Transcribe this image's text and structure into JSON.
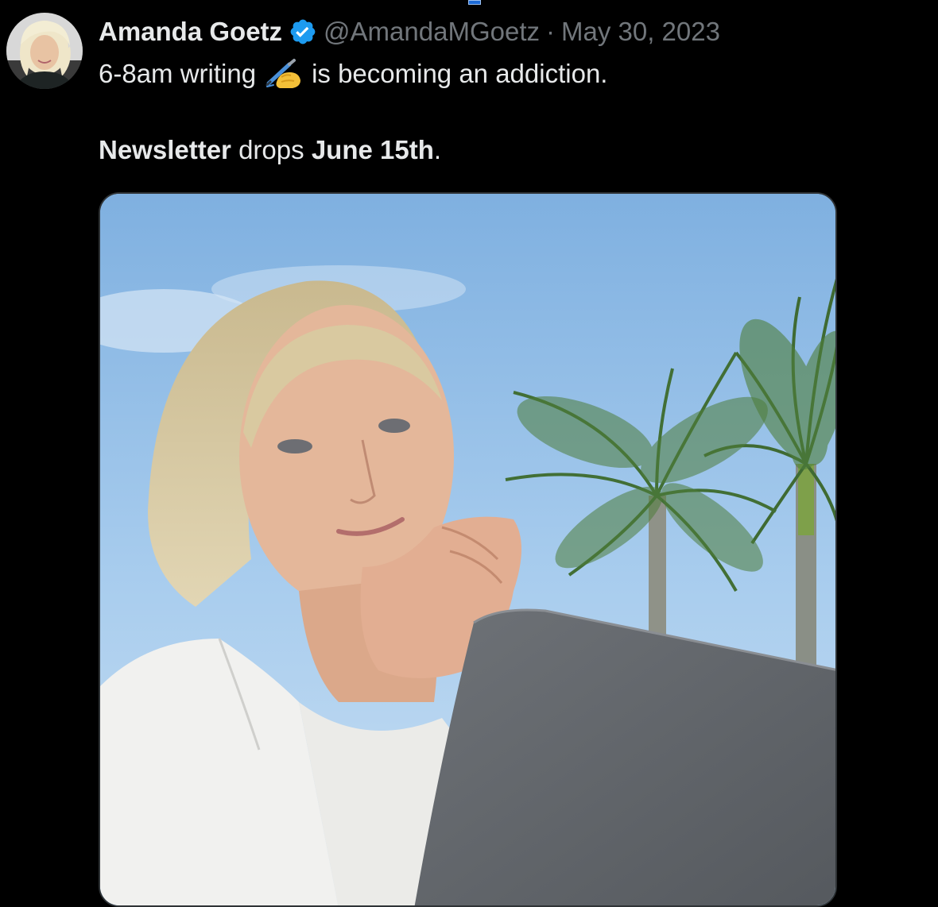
{
  "tweet": {
    "author": {
      "display_name": "Amanda Goetz",
      "handle": "@AmandaMGoetz",
      "verified": true
    },
    "separator": "·",
    "date": "May 30, 2023",
    "text": {
      "line1_before": "6-8am writing",
      "emoji": "writing-hand-emoji",
      "line1_after": "is becoming an addiction.",
      "line2_bold1": "Newsletter",
      "line2_mid": "drops",
      "line2_bold2": "June 15th",
      "line2_end": "."
    },
    "media": {
      "type": "photo"
    }
  },
  "colors": {
    "background": "#000000",
    "text_primary": "#e7e9ea",
    "text_secondary": "#71767b",
    "verified_blue": "#1d9bf0"
  }
}
